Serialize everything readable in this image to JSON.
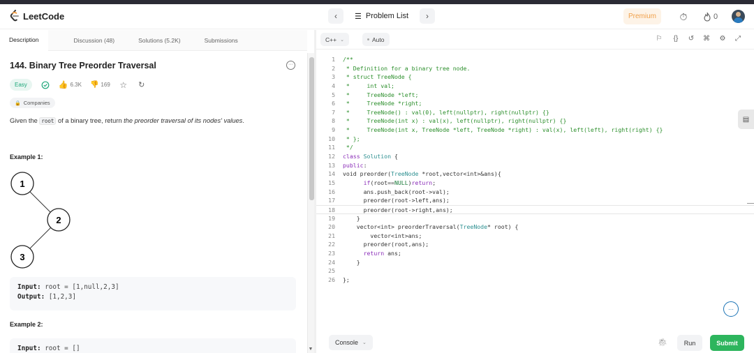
{
  "app": {
    "name": "LeetCode"
  },
  "nav": {
    "problem_list": "Problem List",
    "premium": "Premium",
    "fire_count": "0"
  },
  "tabs": [
    {
      "label": "Description",
      "active": true
    },
    {
      "label": "Discussion (48)"
    },
    {
      "label": "Solutions (5.2K)"
    },
    {
      "label": "Submissions"
    }
  ],
  "problem": {
    "title": "144. Binary Tree Preorder Traversal",
    "difficulty": "Easy",
    "likes": "6.3K",
    "dislikes": "169",
    "companies": "Companies",
    "desc_pre": "Given the ",
    "desc_code": "root",
    "desc_mid": " of a binary tree, return ",
    "desc_em": "the preorder traversal of its nodes' values",
    "desc_post": "."
  },
  "examples": [
    {
      "title": "Example 1:",
      "tree": [
        "1",
        "2",
        "3"
      ],
      "input_label": "Input:",
      "input": " root = [1,null,2,3]",
      "output_label": "Output:",
      "output": " [1,2,3]"
    },
    {
      "title": "Example 2:",
      "input_label": "Input:",
      "input": " root = []"
    }
  ],
  "editor": {
    "language": "C++",
    "mode": "Auto",
    "console": "Console",
    "run": "Run",
    "submit": "Submit",
    "current_line": 18,
    "lines": [
      "/**",
      " * Definition for a binary tree node.",
      " * struct TreeNode {",
      " *     int val;",
      " *     TreeNode *left;",
      " *     TreeNode *right;",
      " *     TreeNode() : val(0), left(nullptr), right(nullptr) {}",
      " *     TreeNode(int x) : val(x), left(nullptr), right(nullptr) {}",
      " *     TreeNode(int x, TreeNode *left, TreeNode *right) : val(x), left(left), right(right) {}",
      " * };",
      " */",
      "class Solution {",
      "public:",
      "void preorder(TreeNode *root,vector<int>&ans){",
      "      if(root==NULL)return;",
      "      ans.push_back(root->val);",
      "      preorder(root->left,ans);",
      "      preorder(root->right,ans);",
      "    }",
      "    vector<int> preorderTraversal(TreeNode* root) {",
      "        vector<int>ans;",
      "      preorder(root,ans);",
      "      return ans;",
      "    }",
      "",
      "};"
    ]
  }
}
